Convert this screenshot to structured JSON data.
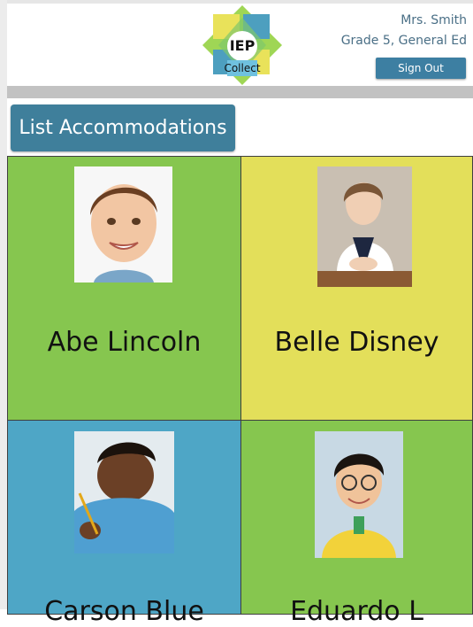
{
  "header": {
    "logo": {
      "line1": "IEP",
      "line2": "Collect"
    },
    "user_name": "Mrs. Smith",
    "user_grade": "Grade 5, General Ed",
    "sign_out_label": "Sign Out"
  },
  "toolbar": {
    "list_accommodations_label": "List Accommodations"
  },
  "students": [
    {
      "name": "Abe Lincoln",
      "card_color": "#86c64f"
    },
    {
      "name": "Belle Disney",
      "card_color": "#e3df5a"
    },
    {
      "name": "Carson Blue",
      "card_color": "#4ea6c6"
    },
    {
      "name": "Eduardo L",
      "card_color": "#86c64f"
    }
  ],
  "colors": {
    "button_blue": "#3f7f9b",
    "user_text": "#4a6f86",
    "gray_band": "#c2c2c2"
  }
}
